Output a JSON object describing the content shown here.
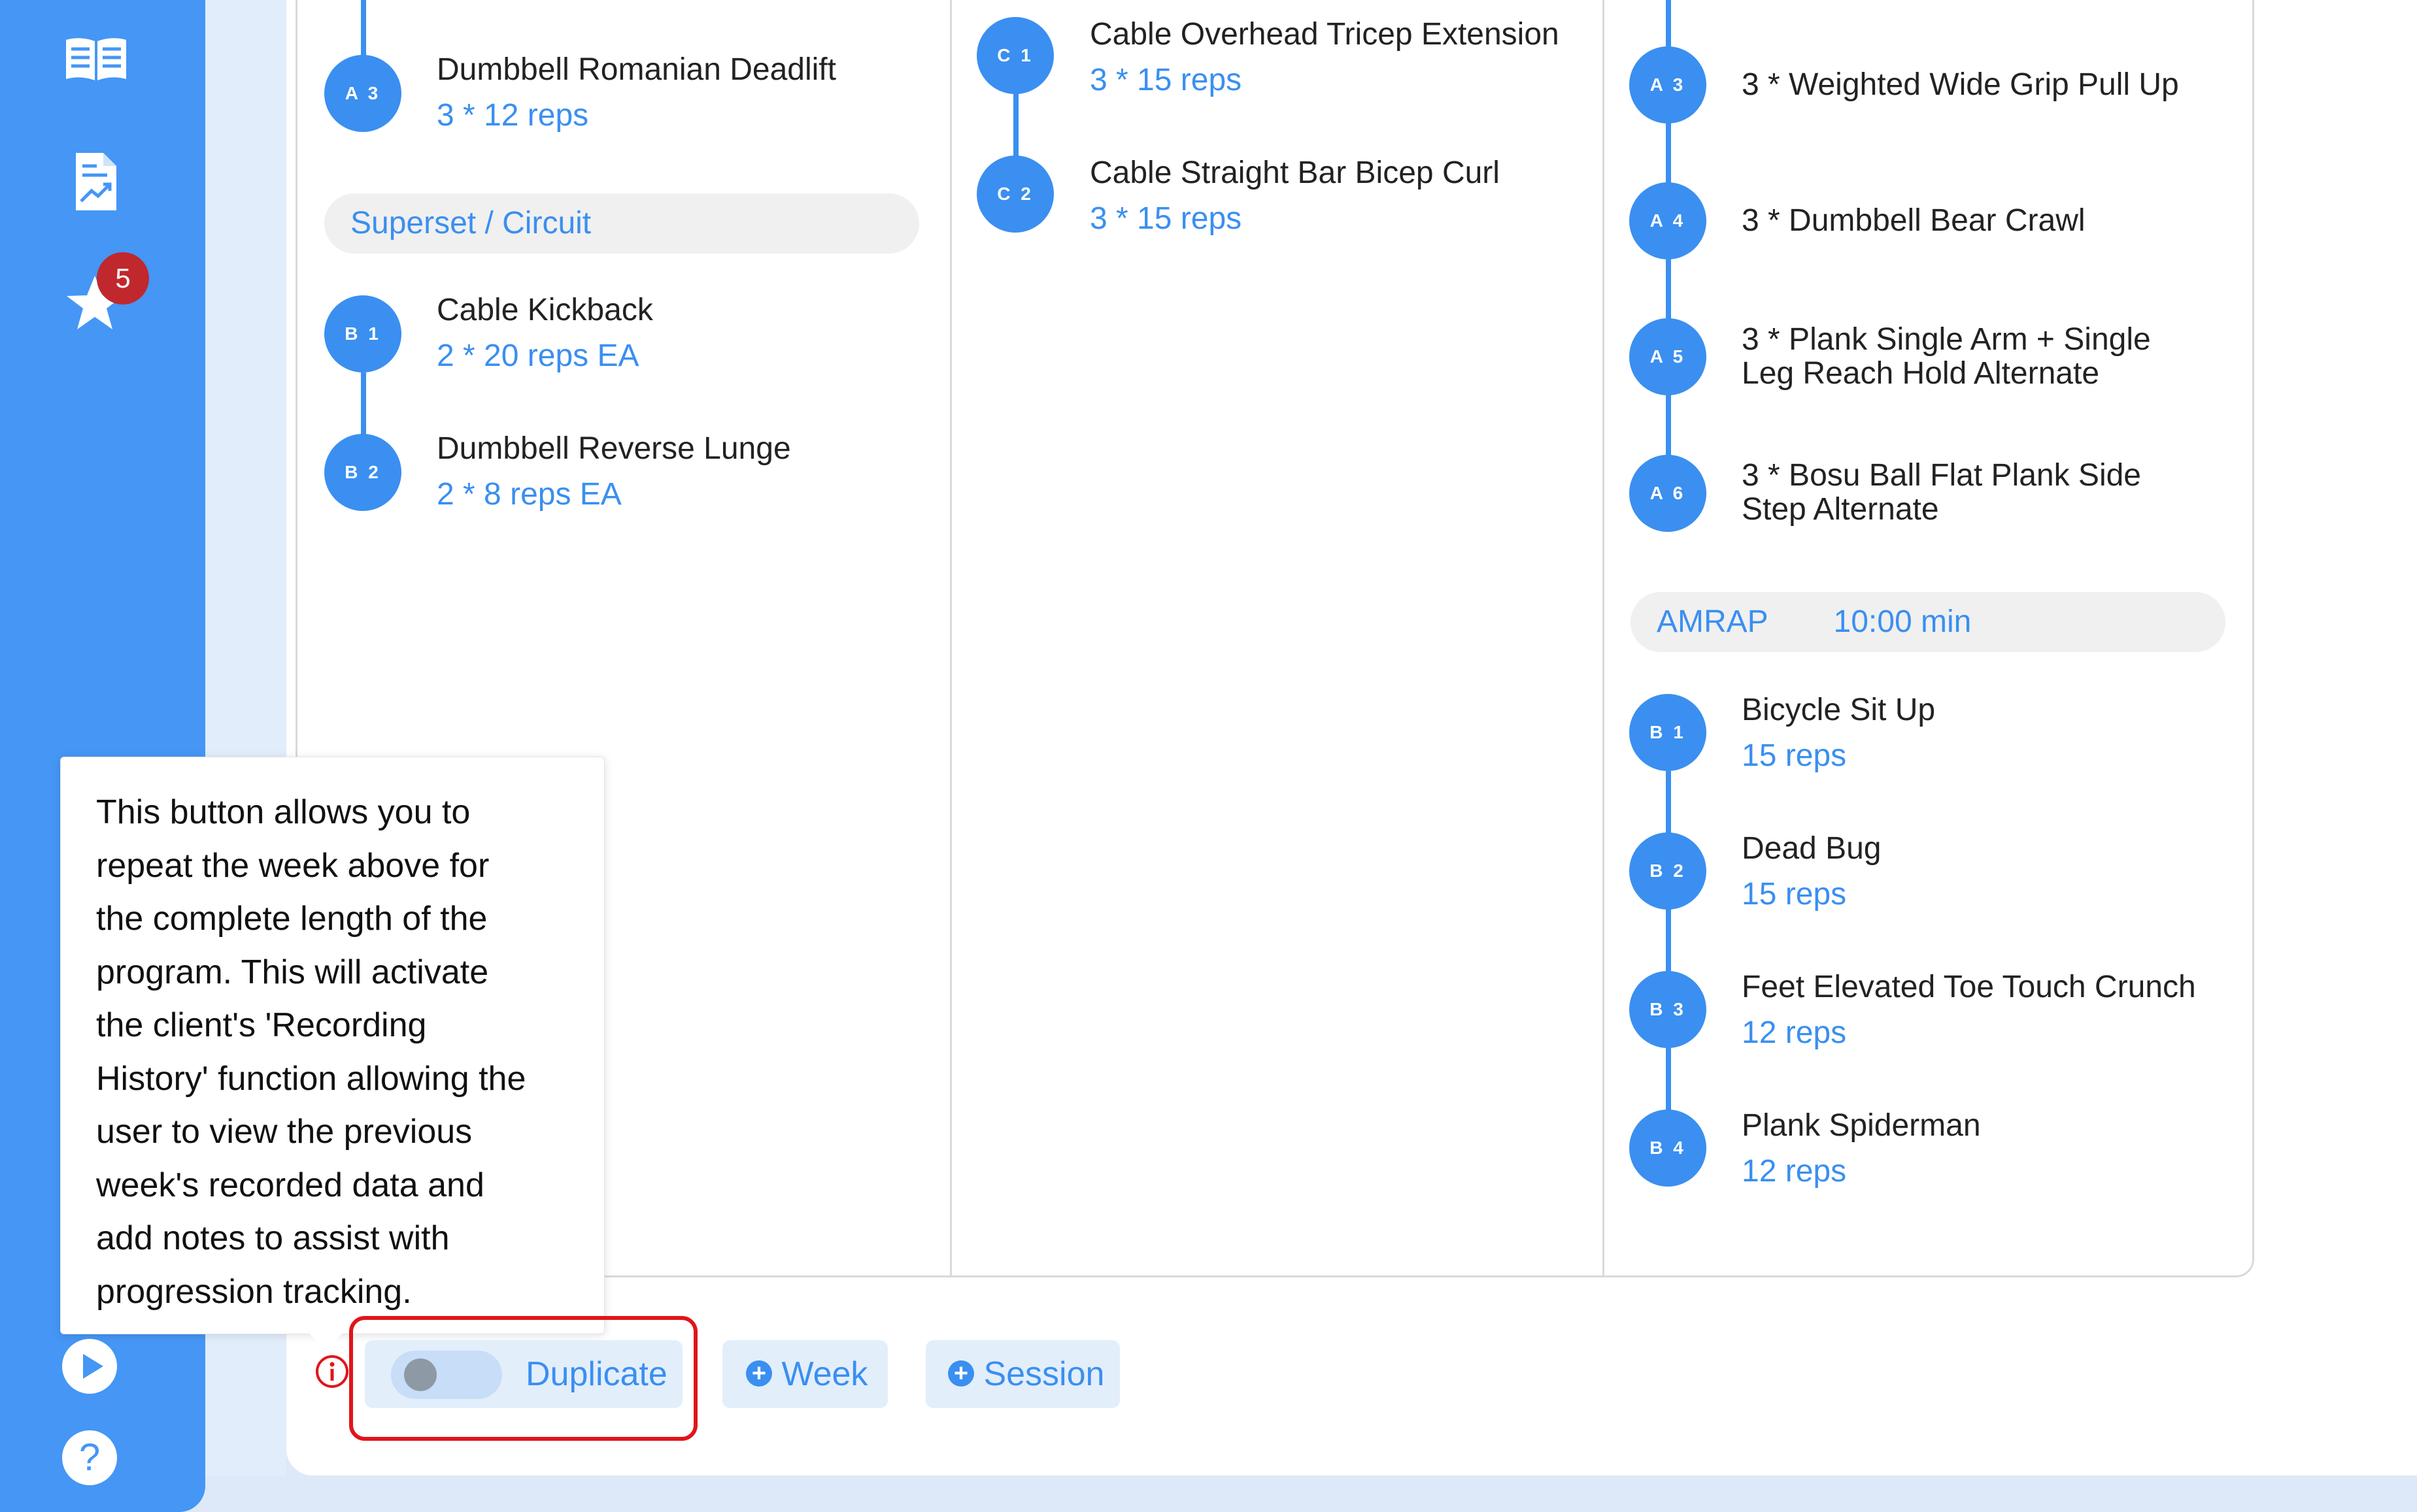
{
  "sidebar": {
    "badge_count": "5",
    "icons": [
      "book-icon",
      "report-chart-icon",
      "star-icon",
      "play-icon",
      "help-icon"
    ]
  },
  "columns": [
    {
      "items": [
        {
          "label": "A 3",
          "name": "Dumbbell Romanian Deadlift",
          "reps": "3 * 12 reps"
        }
      ],
      "group_label": "Superset / Circuit",
      "group_items": [
        {
          "label": "B 1",
          "name": "Cable Kickback",
          "reps": "2 * 20 reps EA"
        },
        {
          "label": "B 2",
          "name": "Dumbbell Reverse Lunge",
          "reps": "2 * 8 reps EA"
        }
      ]
    },
    {
      "items": [
        {
          "label": "C 1",
          "name": "Cable Overhead Tricep Extension",
          "reps": "3 * 15 reps"
        },
        {
          "label": "C 2",
          "name": "Cable Straight Bar Bicep Curl",
          "reps": "3 * 15 reps"
        }
      ]
    },
    {
      "items": [
        {
          "label": "A 3",
          "text_lines": [
            "3 * Weighted Wide Grip Pull Up"
          ]
        },
        {
          "label": "A 4",
          "text_lines": [
            "3 * Dumbbell Bear Crawl"
          ]
        },
        {
          "label": "A 5",
          "text_lines": [
            "3 * Plank Single Arm + Single",
            "Leg Reach Hold Alternate"
          ]
        },
        {
          "label": "A 6",
          "text_lines": [
            "3 * Bosu Ball Flat Plank Side",
            "Step Alternate"
          ]
        }
      ],
      "group_label": "AMRAP",
      "group_value": "10:00 min",
      "group_items": [
        {
          "label": "B 1",
          "name": "Bicycle Sit Up",
          "reps": "15 reps"
        },
        {
          "label": "B 2",
          "name": "Dead Bug",
          "reps": "15 reps"
        },
        {
          "label": "B 3",
          "name": "Feet Elevated Toe Touch Crunch",
          "reps": "12 reps"
        },
        {
          "label": "B 4",
          "name": "Plank Spiderman",
          "reps": "12 reps"
        }
      ]
    }
  ],
  "tooltip": {
    "lines": [
      "This button allows you to",
      "repeat the week above for",
      "the complete length of the",
      "program. This will activate",
      "the client's 'Recording",
      "History' function allowing the",
      "user to view the previous",
      "week's recorded data and",
      "add notes to assist with",
      "progression tracking."
    ]
  },
  "toolbar": {
    "duplicate_label": "Duplicate",
    "duplicate_on": false,
    "week_label": "Week",
    "session_label": "Session"
  },
  "colors": {
    "accent": "#3a8ff0",
    "sidebar": "#4596f5",
    "badge": "#c0282d",
    "highlight": "#e0151a"
  }
}
